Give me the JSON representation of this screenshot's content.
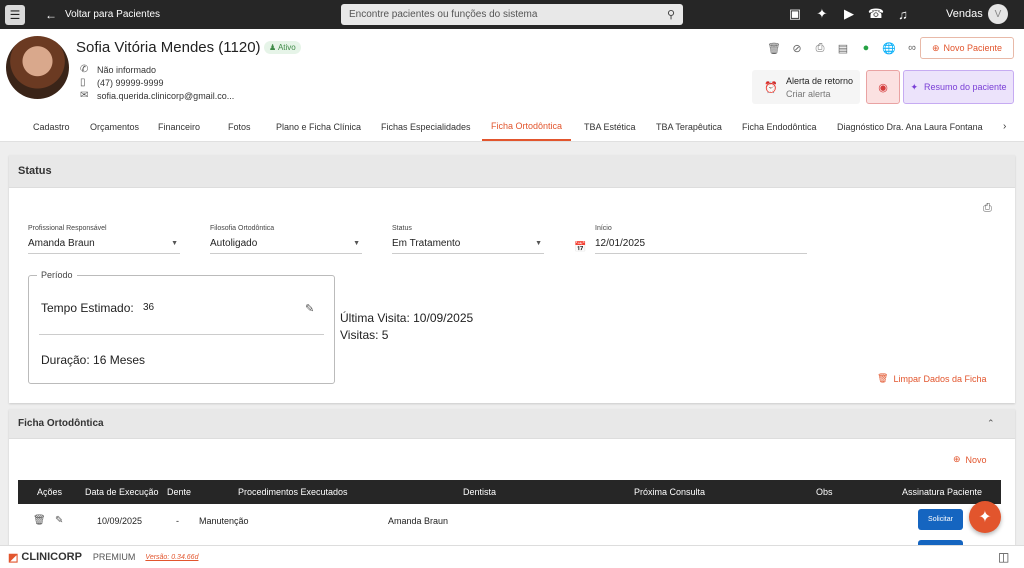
{
  "topbar": {
    "back_label": "Voltar para Pacientes",
    "search_placeholder": "Encontre pacientes ou funções do sistema",
    "user_label": "Vendas",
    "user_initial": "V"
  },
  "patient": {
    "name": "Sofia Vitória Mendes (1120)",
    "status": "Ativo",
    "phone_fixed": "Não informado",
    "phone_mobile": "(47) 99999-9999",
    "email": "sofia.querida.clinicorp@gmail.co..."
  },
  "actions": {
    "novo_paciente": "Novo Paciente",
    "alerta_title": "Alerta de retorno",
    "alerta_sub": "Criar alerta",
    "resumo": "Resumo do paciente"
  },
  "tabs": [
    {
      "label": "Cadastro"
    },
    {
      "label": "Orçamentos"
    },
    {
      "label": "Financeiro"
    },
    {
      "label": "Fotos"
    },
    {
      "label": "Plano e Ficha Clínica"
    },
    {
      "label": "Fichas Especialidades"
    },
    {
      "label": "Ficha Ortodôntica"
    },
    {
      "label": "TBA Estética"
    },
    {
      "label": "TBA Terapêutica"
    },
    {
      "label": "Ficha Endodôntica"
    },
    {
      "label": "Diagnóstico Dra. Ana Laura Fontana"
    }
  ],
  "status_section": {
    "title": "Status",
    "fields": {
      "profissional": {
        "label": "Profissional Responsável",
        "value": "Amanda Braun"
      },
      "filosofia": {
        "label": "Filosofia Ortodôntica",
        "value": "Autoligado"
      },
      "status": {
        "label": "Status",
        "value": "Em Tratamento"
      },
      "inicio": {
        "label": "Início",
        "value": "12/01/2025"
      }
    },
    "periodo": {
      "legend": "Período",
      "tempo_label": "Tempo Estimado:",
      "tempo_value": "36",
      "duracao": "Duração: 16 Meses"
    },
    "ultima_visita": "Última Visita: 10/09/2025",
    "visitas": "Visitas: 5",
    "limpar": "Limpar Dados da Ficha"
  },
  "ficha_section": {
    "title": "Ficha Ortodôntica",
    "novo": "Novo",
    "columns": [
      "Ações",
      "Data de Execução",
      "Dente",
      "Procedimentos Executados",
      "Dentista",
      "Próxima Consulta",
      "Obs",
      "Assinatura Paciente"
    ],
    "rows": [
      {
        "data": "10/09/2025",
        "dente": "-",
        "procedimento": "Manutenção",
        "dentista": "Amanda Braun",
        "proxima": "",
        "obs": "",
        "assinatura": "Solicitar"
      }
    ]
  },
  "footer": {
    "brand": "CLINICORP",
    "plan": "PREMIUM",
    "version": "Versão: 0.34.66d"
  }
}
